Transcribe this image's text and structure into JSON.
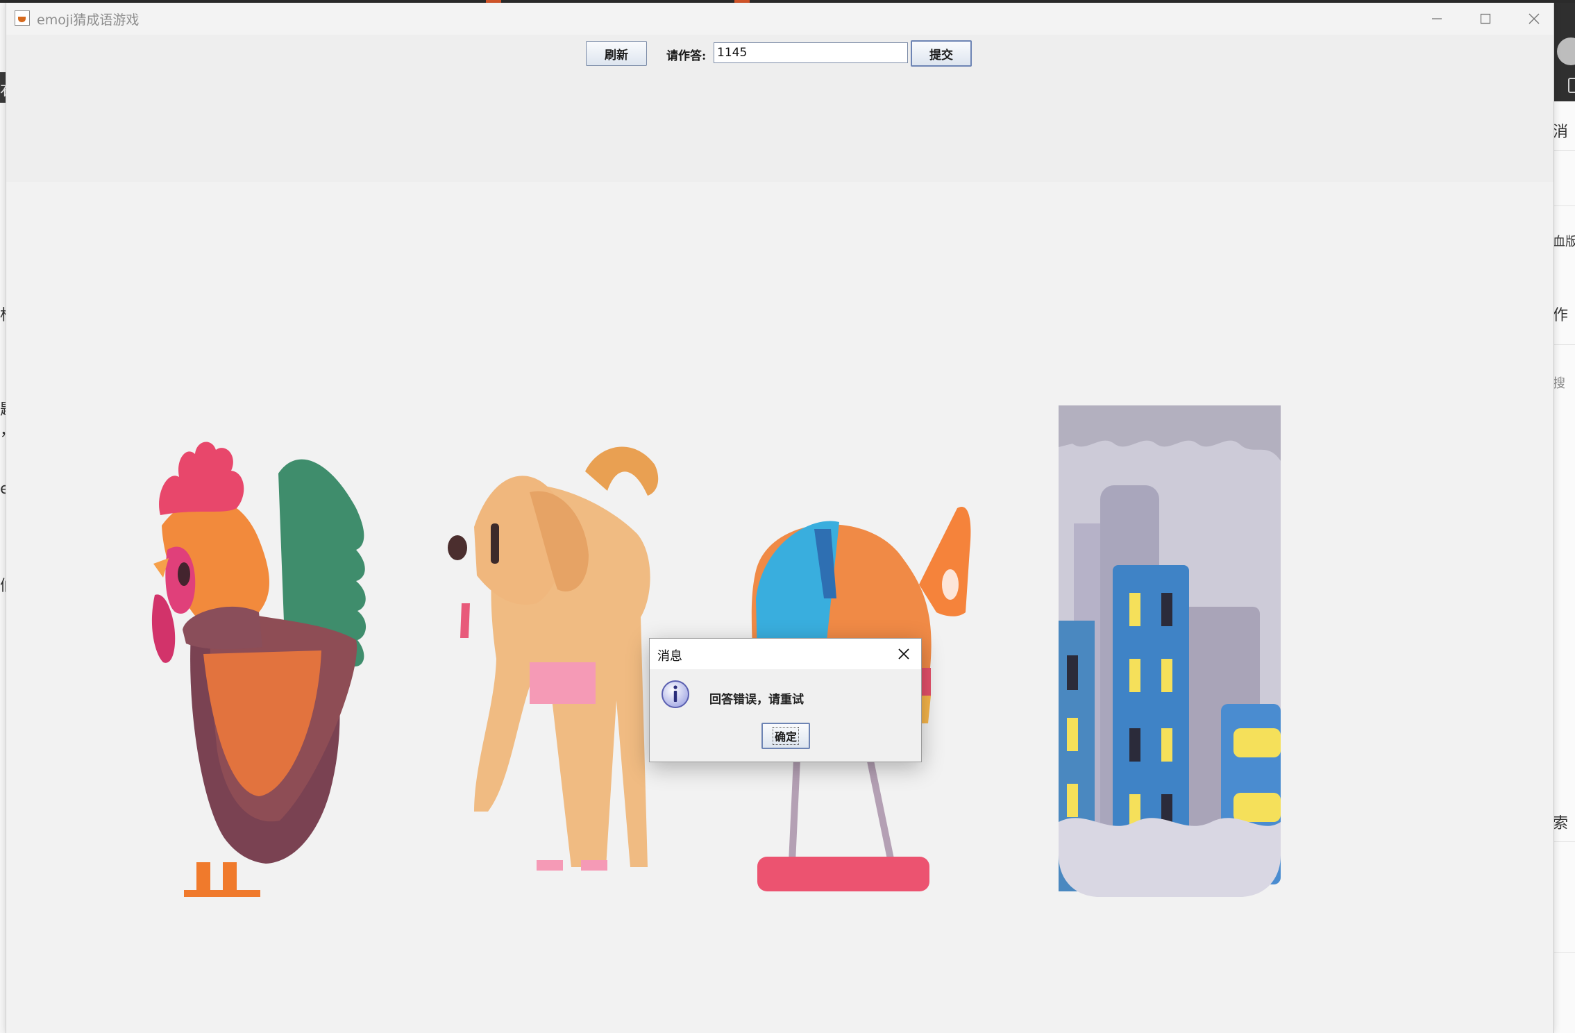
{
  "background_app": {
    "left_fragments": [
      "右",
      "标",
      "题",
      "，",
      "e",
      "们"
    ],
    "right_fragments": [
      "消",
      "血版",
      "作",
      "搜",
      "索"
    ]
  },
  "window": {
    "title": "emoji猜成语游戏",
    "controls": {
      "minimize": "minimize-icon",
      "maximize": "maximize-icon",
      "close": "close-icon"
    }
  },
  "toolbar": {
    "refresh_label": "刷新",
    "answer_label": "请作答:",
    "answer_value": "1145",
    "submit_label": "提交"
  },
  "stage": {
    "emojis": [
      {
        "name": "rooster-emoji"
      },
      {
        "name": "dog-emoji"
      },
      {
        "name": "helicopter-emoji"
      },
      {
        "name": "cityscape-emoji"
      }
    ]
  },
  "dialog": {
    "title": "消息",
    "icon": "info-icon",
    "message": "回答错误，请重试",
    "ok_label": "确定"
  }
}
